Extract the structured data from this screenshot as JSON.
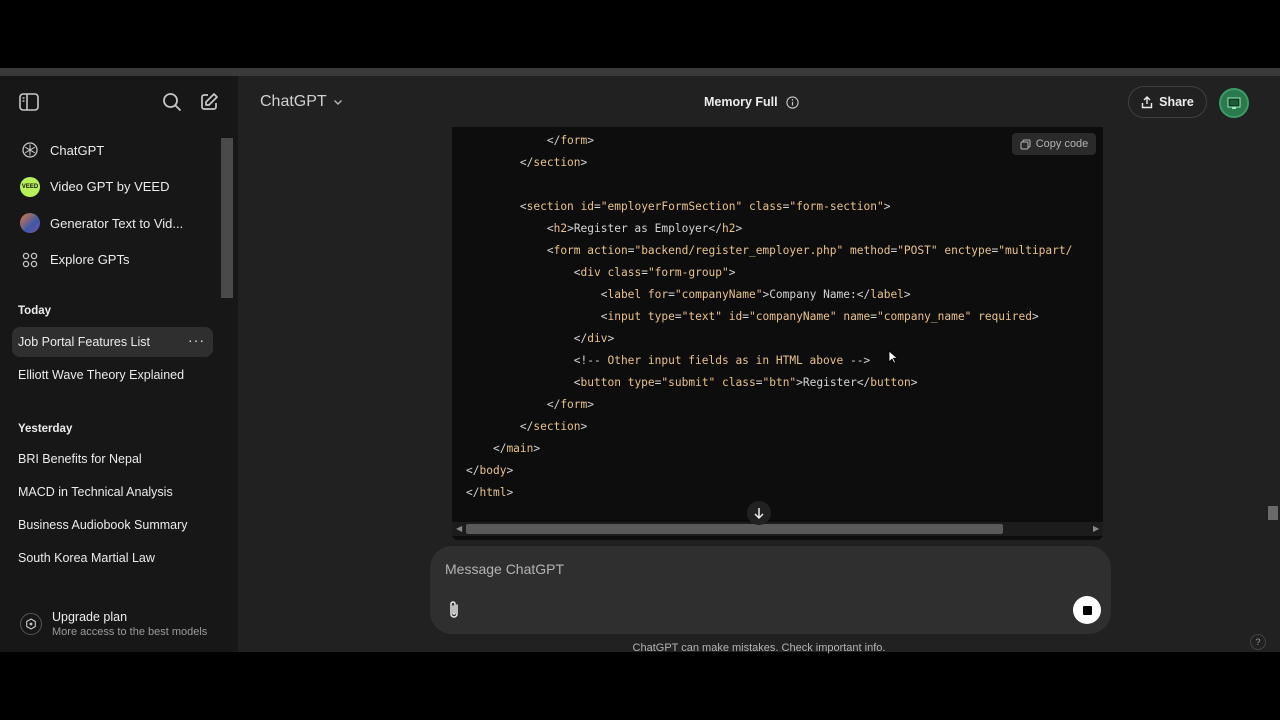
{
  "sidebar": {
    "icons": {
      "toggle": "sidebar-toggle-icon",
      "search": "search-icon",
      "new_chat": "new-chat-icon"
    },
    "nav": [
      {
        "label": "ChatGPT",
        "icon": "openai-logo-icon"
      },
      {
        "label": "Video GPT by VEED",
        "icon": "veed-logo-icon"
      },
      {
        "label": "Generator Text to Vid...",
        "icon": "generator-avatar-icon"
      },
      {
        "label": "Explore GPTs",
        "icon": "grid-icon"
      }
    ],
    "today_label": "Today",
    "today": [
      {
        "label": "Job Portal Features List",
        "active": true,
        "more": "···"
      },
      {
        "label": "Elliott Wave Theory Explained"
      }
    ],
    "yesterday_label": "Yesterday",
    "yesterday": [
      {
        "label": "BRI Benefits for Nepal"
      },
      {
        "label": "MACD in Technical Analysis"
      },
      {
        "label": "Business Audiobook Summary"
      },
      {
        "label": "South Korea Martial Law"
      }
    ],
    "upgrade": {
      "title": "Upgrade plan",
      "subtitle": "More access to the best models"
    }
  },
  "header": {
    "model": "ChatGPT",
    "memory": "Memory Full",
    "share": "Share"
  },
  "code_block": {
    "copy_label": "Copy code"
  },
  "composer": {
    "placeholder": "Message ChatGPT"
  },
  "disclaimer": "ChatGPT can make mistakes. Check important info.",
  "help": "?",
  "colors": {
    "background": "#212121",
    "sidebar": "#171717",
    "code_bg": "#0d0d0d",
    "code_accent": "#e9c28b"
  }
}
